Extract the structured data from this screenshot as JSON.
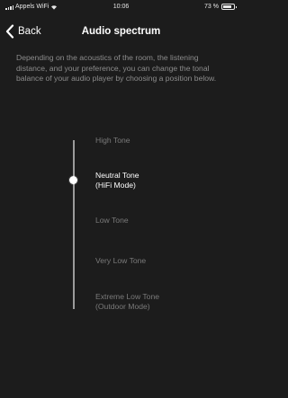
{
  "status_bar": {
    "carrier": "Appels WiFi",
    "time": "10:06",
    "battery_percent_label": "73 %",
    "battery_level": 0.73
  },
  "nav": {
    "back_label": "Back",
    "title": "Audio spectrum"
  },
  "description": "Depending on the acoustics of the room, the listening distance, and your preference, you can change the tonal balance of your audio player by choosing a position below.",
  "tone_options": [
    {
      "label": "High Tone",
      "selected": false
    },
    {
      "label": "Neutral Tone\n(HiFi Mode)",
      "selected": true
    },
    {
      "label": "Low Tone",
      "selected": false
    },
    {
      "label": "Very Low Tone",
      "selected": false
    },
    {
      "label": "Extreme Low Tone\n(Outdoor Mode)",
      "selected": false
    }
  ],
  "colors": {
    "background": "#1c1c1c",
    "selected_text": "#ffffff",
    "unselected_text": "#7a7a7a",
    "description_text": "#8c8c8c"
  },
  "icons": [
    "signal-icon",
    "wifi-icon",
    "battery-icon",
    "back-chevron-icon",
    "slider-knob"
  ]
}
